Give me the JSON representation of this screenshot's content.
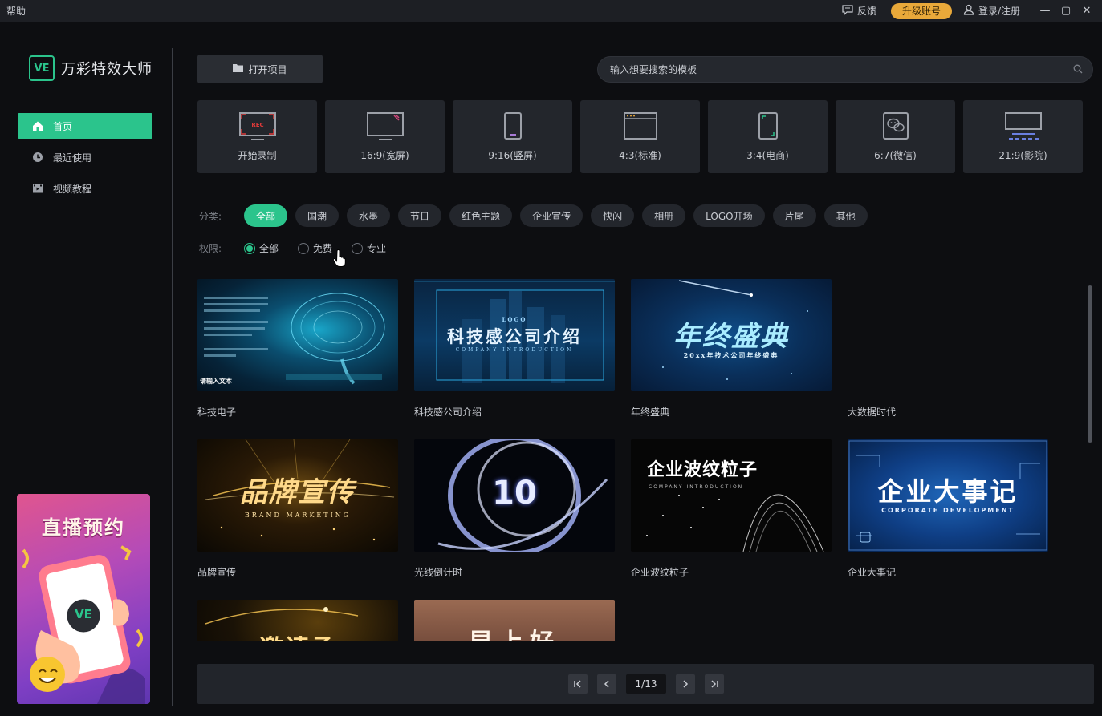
{
  "titlebar": {
    "help": "帮助",
    "feedback": "反馈",
    "upgrade": "升级账号",
    "login": "登录/注册"
  },
  "app": {
    "logo_mark": "VE",
    "name": "万彩特效大师"
  },
  "sidebar": {
    "items": [
      {
        "label": "首页",
        "icon": "home-icon",
        "active": true
      },
      {
        "label": "最近使用",
        "icon": "clock-icon",
        "active": false
      },
      {
        "label": "视频教程",
        "icon": "video-icon",
        "active": false
      }
    ],
    "promo": {
      "title": "直播预约",
      "badge": "VE"
    }
  },
  "toolbar": {
    "open_project": "打开项目",
    "search_placeholder": "输入想要搜索的模板"
  },
  "ratios": [
    {
      "label": "开始录制",
      "icon": "record-icon",
      "rec": "REC"
    },
    {
      "label": "16:9(宽屏)",
      "icon": "widescreen-icon"
    },
    {
      "label": "9:16(竖屏)",
      "icon": "portrait-icon"
    },
    {
      "label": "4:3(标准)",
      "icon": "standard-icon"
    },
    {
      "label": "3:4(电商)",
      "icon": "ecommerce-icon"
    },
    {
      "label": "6:7(微信)",
      "icon": "wechat-icon"
    },
    {
      "label": "21:9(影院)",
      "icon": "cinema-icon"
    }
  ],
  "filters": {
    "category_label": "分类:",
    "categories": [
      "全部",
      "国潮",
      "水墨",
      "节日",
      "红色主题",
      "企业宣传",
      "快闪",
      "相册",
      "LOGO开场",
      "片尾",
      "其他"
    ],
    "active_category": "全部",
    "permission_label": "权限:",
    "permissions": [
      "全部",
      "免费",
      "专业"
    ],
    "active_permission": "全部"
  },
  "templates": [
    {
      "name": "科技电子",
      "thumb_text": "请输入文本"
    },
    {
      "name": "科技感公司介绍",
      "thumb_text": "科技感公司介绍",
      "thumb_sub": "COMPANY INTRODUCTION",
      "thumb_logo": "LOGO"
    },
    {
      "name": "年终盛典",
      "thumb_text": "年终盛典",
      "thumb_sub": "20xx年技术公司年终盛典"
    },
    {
      "name": "大数据时代"
    },
    {
      "name": "品牌宣传",
      "thumb_text": "品牌宣传",
      "thumb_sub": "BRAND MARKETING"
    },
    {
      "name": "光线倒计时",
      "thumb_text": "10"
    },
    {
      "name": "企业波纹粒子",
      "thumb_text": "企业波纹粒子",
      "thumb_sub": "COMPANY INTRODUCTION"
    },
    {
      "name": "企业大事记",
      "thumb_text": "企业大事记",
      "thumb_sub": "CORPORATE DEVELOPMENT"
    },
    {
      "thumb_text": "邀请函"
    },
    {
      "thumb_text": "早上好"
    }
  ],
  "pagination": {
    "current": "1/13"
  }
}
